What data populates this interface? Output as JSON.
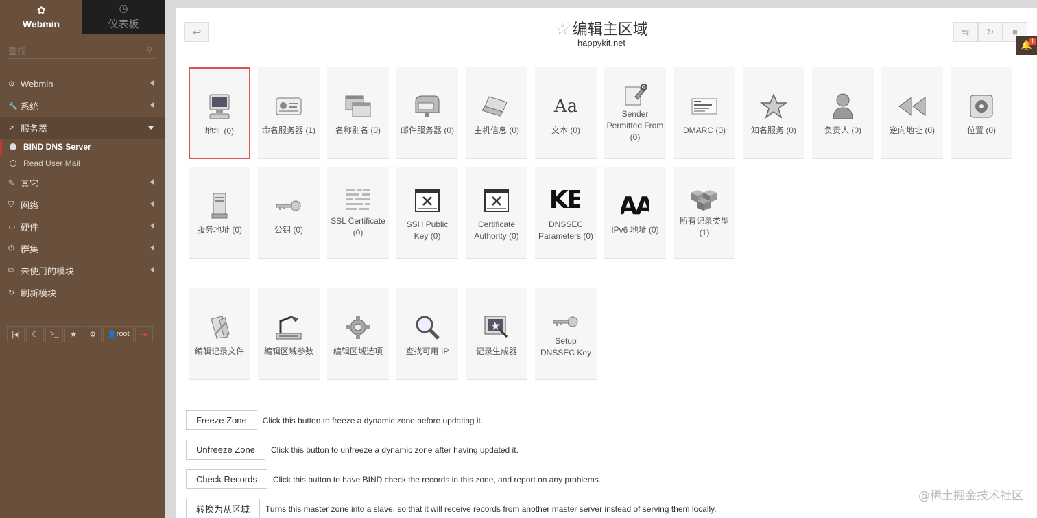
{
  "sidebar": {
    "tabs": [
      {
        "label": "Webmin",
        "icon": "webmin-logo-icon"
      },
      {
        "label": "仪表板",
        "icon": "dashboard-icon"
      }
    ],
    "search_placeholder": "查找",
    "menu": [
      {
        "label": "Webmin",
        "icon": "gear-icon"
      },
      {
        "label": "系统",
        "icon": "wrench-icon"
      },
      {
        "label": "服务器",
        "icon": "rocket-icon",
        "open": true
      },
      {
        "label": "其它",
        "icon": "tools-icon"
      },
      {
        "label": "网络",
        "icon": "shield-icon"
      },
      {
        "label": "硬件",
        "icon": "hdd-icon"
      },
      {
        "label": "群集",
        "icon": "power-icon"
      },
      {
        "label": "未使用的模块",
        "icon": "puzzle-icon"
      },
      {
        "label": "刷新模块",
        "icon": "refresh-icon"
      }
    ],
    "submenu": [
      {
        "label": "BIND DNS Server",
        "active": true
      },
      {
        "label": "Read User Mail",
        "active": false
      }
    ],
    "toolbar": {
      "user": "root"
    }
  },
  "header": {
    "title": "编辑主区域",
    "subtitle": "happykit.net"
  },
  "notification_count": "1",
  "records": [
    {
      "label": "地址 (0)",
      "icon": "computer-icon"
    },
    {
      "label": "命名服务器 (1)",
      "icon": "id-card-icon"
    },
    {
      "label": "名称别名 (0)",
      "icon": "windows-stack-icon"
    },
    {
      "label": "邮件服务器 (0)",
      "icon": "mailbox-icon"
    },
    {
      "label": "主机信息 (0)",
      "icon": "laptop-icon"
    },
    {
      "label": "文本 (0)",
      "icon": "text-aa-icon"
    },
    {
      "label": "Sender Permitted From (0)",
      "icon": "wrench-doc-icon"
    },
    {
      "label": "DMARC (0)",
      "icon": "dmarc-card-icon"
    },
    {
      "label": "知名服务 (0)",
      "icon": "star-icon"
    },
    {
      "label": "负责人 (0)",
      "icon": "person-icon"
    },
    {
      "label": "逆向地址 (0)",
      "icon": "rewind-icon"
    },
    {
      "label": "位置 (0)",
      "icon": "location-icon"
    },
    {
      "label": "服务地址 (0)",
      "icon": "server-icon"
    },
    {
      "label": "公钥 (0)",
      "icon": "key-icon"
    },
    {
      "label": "SSL Certificate (0)",
      "icon": "certificate-text-icon"
    },
    {
      "label": "SSH Public Key (0)",
      "icon": "image-not-found-icon"
    },
    {
      "label": "Certificate Authority (0)",
      "icon": "image-not-found-icon"
    },
    {
      "label": "DNSSEC Parameters (0)",
      "icon": "ke-text-icon"
    },
    {
      "label": "IPv6 地址 (0)",
      "icon": "aa-text-icon"
    },
    {
      "label": "所有记录类型 (1)",
      "icon": "cubes-icon"
    }
  ],
  "tools": [
    {
      "label": "编辑记录文件",
      "icon": "edit-file-icon"
    },
    {
      "label": "编辑区域参数",
      "icon": "desk-lamp-icon"
    },
    {
      "label": "编辑区域选项",
      "icon": "cog-icon"
    },
    {
      "label": "查找可用 IP",
      "icon": "magnifier-icon"
    },
    {
      "label": "记录生成器",
      "icon": "generator-icon"
    },
    {
      "label": "Setup DNSSEC Key",
      "icon": "key-icon"
    }
  ],
  "icon_text": {
    "text_aa": "Aa",
    "ke": "KE",
    "aa": "AA"
  },
  "actions": [
    {
      "button": "Freeze Zone",
      "desc": "Click this button to freeze a dynamic zone before updating it."
    },
    {
      "button": "Unfreeze Zone",
      "desc": "Click this button to unfreeze a dynamic zone after having updated it."
    },
    {
      "button": "Check Records",
      "desc": "Click this button to have BIND check the records in this zone, and report on any problems."
    },
    {
      "button": "转换为从区域",
      "desc": "Turns this master zone into a slave, so that it will receive records from another master server instead of serving them locally."
    }
  ],
  "watermark": "@稀土掘金技术社区"
}
